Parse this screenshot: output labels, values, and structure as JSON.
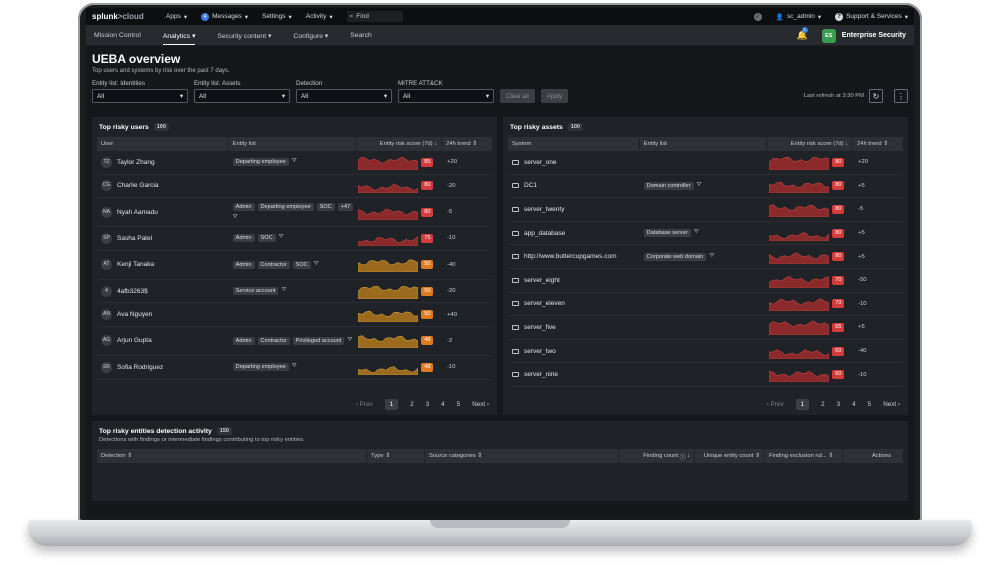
{
  "topbar": {
    "logo_main": "splunk",
    "logo_suffix": ">cloud",
    "apps": "Apps",
    "messages_count": "4",
    "messages": "Messages",
    "settings": "Settings",
    "activity": "Activity",
    "find": "Find",
    "user": "sc_admin",
    "support": "Support & Services"
  },
  "nav": {
    "tabs": [
      "Mission Control",
      "Analytics",
      "Security content",
      "Configure",
      "Search"
    ],
    "notif_count": "1",
    "app_badge": "ES",
    "app_name": "Enterprise Security"
  },
  "header": {
    "title": "UEBA overview",
    "subtitle": "Top users and systems by risk over the past 7 days."
  },
  "filters": [
    {
      "label": "Entity list: Identities",
      "value": "All"
    },
    {
      "label": "Entity list: Assets",
      "value": "All"
    },
    {
      "label": "Detection",
      "value": "All"
    },
    {
      "label": "MITRE ATT&CK",
      "value": "All"
    }
  ],
  "buttons": {
    "clear": "Clear all",
    "apply": "Apply"
  },
  "refresh_text": "Last refresh at 3:30 PM",
  "colors": {
    "high": "#d63b3b",
    "medium": "#e07a1f",
    "spark_red": "#8a2a2a",
    "spark_orange": "#9a6a1e"
  },
  "users_panel": {
    "title": "Top risky users",
    "count": "100",
    "headers": [
      "User",
      "Entity list",
      "Entity risk score (7d)",
      "24h trend"
    ],
    "rows": [
      {
        "initials": "TZ",
        "name": "Taylor Zhang",
        "tags": [
          "Departing employee"
        ],
        "score": 85,
        "trend": "+20",
        "level": "high"
      },
      {
        "initials": "CG",
        "name": "Charlie Garcia",
        "tags": [],
        "score": 80,
        "trend": "-20",
        "level": "high"
      },
      {
        "initials": "NA",
        "name": "Nyah Aamadu",
        "tags": [
          "Admin",
          "Departing employee",
          "SOC",
          "+47"
        ],
        "score": 80,
        "trend": "-5",
        "level": "high"
      },
      {
        "initials": "SP",
        "name": "Sasha Patel",
        "tags": [
          "Admin",
          "SOC"
        ],
        "score": 75,
        "trend": "-10",
        "level": "high"
      },
      {
        "initials": "AT",
        "name": "Kenji Tanaka",
        "tags": [
          "Admin",
          "Contractor",
          "SOC"
        ],
        "score": 50,
        "trend": "-40",
        "level": "medium"
      },
      {
        "initials": "4",
        "name": "4afb3263$",
        "tags": [
          "Service account"
        ],
        "score": 50,
        "trend": "-20",
        "level": "medium"
      },
      {
        "initials": "AN",
        "name": "Ava Nguyen",
        "tags": [],
        "score": 50,
        "trend": "+40",
        "level": "medium"
      },
      {
        "initials": "AG",
        "name": "Arjun Gupta",
        "tags": [
          "Admin",
          "Contractor",
          "Privileged account"
        ],
        "score": 48,
        "trend": "-2",
        "level": "medium"
      },
      {
        "initials": "SR",
        "name": "Sofia Rodriguez",
        "tags": [
          "Departing employee"
        ],
        "score": 48,
        "trend": "-10",
        "level": "medium"
      }
    ]
  },
  "assets_panel": {
    "title": "Top risky assets",
    "count": "100",
    "headers": [
      "System",
      "Entity list",
      "Entity risk score (7d)",
      "24h trend"
    ],
    "rows": [
      {
        "name": "server_one",
        "tags": [],
        "score": 80,
        "trend": "+20"
      },
      {
        "name": "DC1",
        "tags": [
          "Domain controller"
        ],
        "score": 80,
        "trend": "+5"
      },
      {
        "name": "server_twenty",
        "tags": [],
        "score": 80,
        "trend": "-5"
      },
      {
        "name": "app_database",
        "tags": [
          "Database server"
        ],
        "score": 80,
        "trend": "+5"
      },
      {
        "name": "http://www.buttercupgames.com",
        "tags": [
          "Corporate web domain"
        ],
        "score": 80,
        "trend": "+5"
      },
      {
        "name": "server_eight",
        "tags": [],
        "score": 70,
        "trend": "-50"
      },
      {
        "name": "server_eleven",
        "tags": [],
        "score": 70,
        "trend": "-10"
      },
      {
        "name": "server_five",
        "tags": [],
        "score": 65,
        "trend": "+5"
      },
      {
        "name": "server_two",
        "tags": [],
        "score": 60,
        "trend": "-40"
      },
      {
        "name": "server_nine",
        "tags": [],
        "score": 60,
        "trend": "-10"
      }
    ]
  },
  "pager": {
    "prev": "Prev",
    "next": "Next",
    "pages": [
      "1",
      "2",
      "3",
      "4",
      "5"
    ]
  },
  "detections": {
    "title": "Top risky entities detection activity",
    "count": "150",
    "subtitle": "Detections with findings or intermediate findings contributing to top risky entities.",
    "headers": [
      "Detection",
      "Type",
      "Source categories",
      "Finding count",
      "Unique entity count",
      "Finding exclusion rul...",
      "Actions"
    ]
  }
}
